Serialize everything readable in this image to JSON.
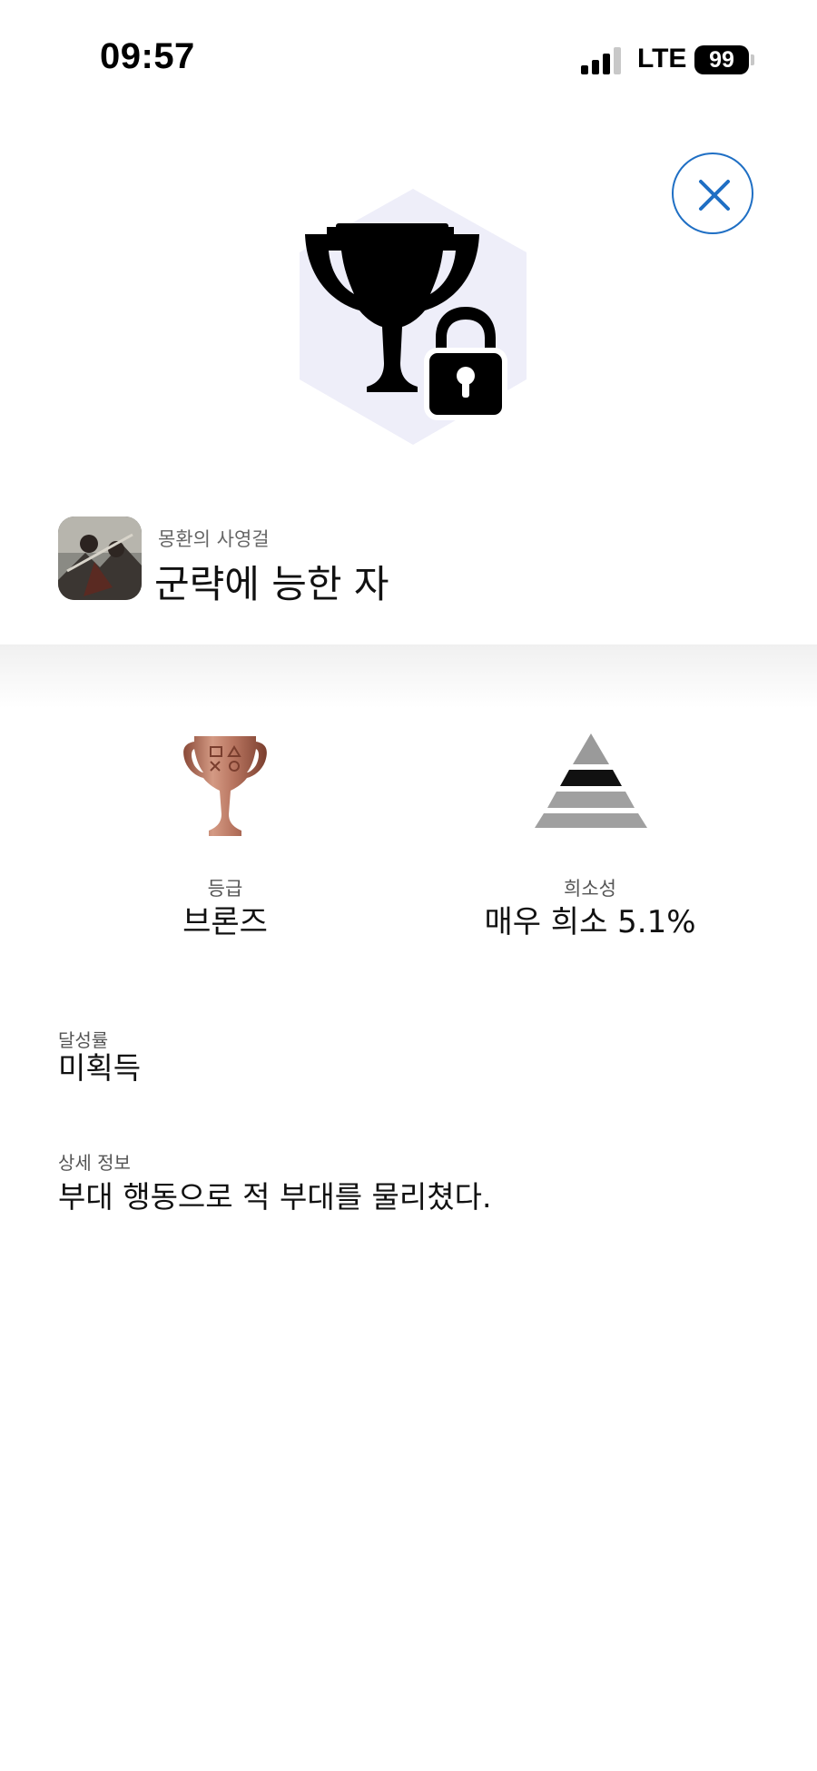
{
  "status_bar": {
    "time": "09:57",
    "network": "LTE",
    "battery": "99"
  },
  "close_icon": "close-icon",
  "hero": {
    "icon": "trophy-lock-icon",
    "hex_color": "#eeeef9"
  },
  "game": {
    "title": "몽환의 사영걸",
    "trophy_name": "군략에 능한 자"
  },
  "stats": {
    "grade_label": "등급",
    "grade_value": "브론즈",
    "rarity_label": "희소성",
    "rarity_value": "매우 희소 5.1%"
  },
  "achievement": {
    "label": "달성률",
    "value": "미획득"
  },
  "details": {
    "label": "상세 정보",
    "value": "부대 행동으로 적 부대를 물리쳤다."
  },
  "colors": {
    "accent": "#1f6fc4",
    "bronze": "#b87560"
  }
}
